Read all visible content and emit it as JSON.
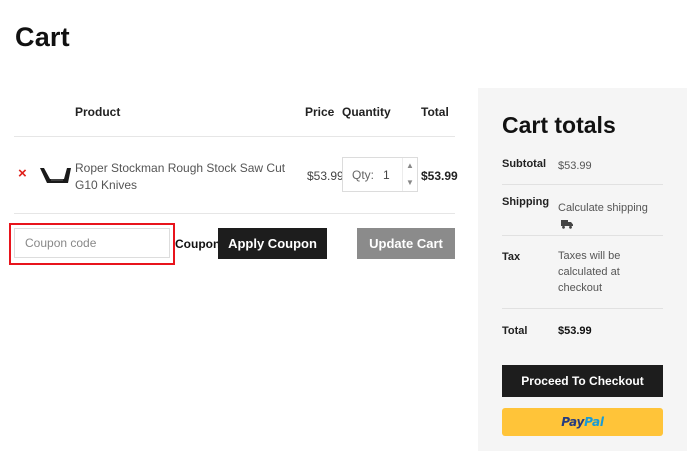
{
  "page": {
    "title": "Cart"
  },
  "cart": {
    "headers": {
      "product": "Product",
      "price": "Price",
      "quantity": "Quantity",
      "total": "Total"
    },
    "items": [
      {
        "remove": "×",
        "name": "Roper Stockman Rough Stock Saw Cut G10 Knives",
        "price": "$53.99",
        "qty_label": "Qty:",
        "qty": "1",
        "total": "$53.99",
        "thumbnail_icon": "folding-knife-icon"
      }
    ]
  },
  "coupon": {
    "placeholder": "Coupon code",
    "label": "Coupon:",
    "apply_label": "Apply Coupon",
    "update_label": "Update Cart",
    "highlight_color": "#e8141c"
  },
  "totals": {
    "title": "Cart totals",
    "subtotal_label": "Subtotal",
    "subtotal_value": "$53.99",
    "shipping_label": "Shipping",
    "shipping_value": "Calculate shipping",
    "tax_label": "Tax",
    "tax_value": "Taxes will be calculated at checkout",
    "total_label": "Total",
    "total_value": "$53.99",
    "checkout_label": "Proceed To Checkout",
    "paypal_part1": "Pay",
    "paypal_part2": "Pal"
  },
  "colors": {
    "dark_button": "#1d1d1d",
    "disabled_button": "#8b8b8b",
    "paypal_yellow": "#ffc439",
    "remove_red": "#e0201b",
    "panel_bg": "#f5f5f5"
  },
  "icons": {
    "remove": "close-x-icon",
    "shipping": "truck-icon",
    "spinner_up": "chevron-up-icon",
    "spinner_down": "chevron-down-icon"
  }
}
